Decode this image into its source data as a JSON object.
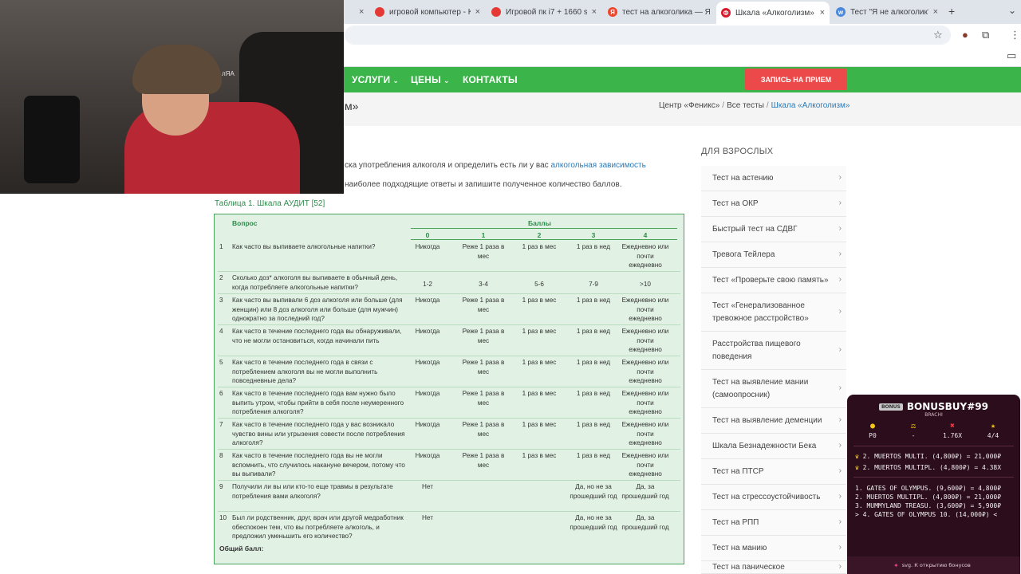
{
  "browser": {
    "tabs": [
      {
        "title": "игровой компьютер - Ку",
        "fav_color": "#e53935",
        "fav": "",
        "active": false
      },
      {
        "title": "Игровой пк i7 + 1660 su",
        "fav_color": "#e53935",
        "fav": "",
        "active": false
      },
      {
        "title": "тест на алкоголика — Ян",
        "fav_color": "#f0452b",
        "fav": "Я",
        "active": false
      },
      {
        "title": "Шкала «Алкоголизм» —",
        "fav_color": "#d81b2c",
        "fav": "Ф",
        "active": true
      },
      {
        "title": "Тест \"Я не алкоголик?\" |",
        "fav_color": "#4a89dc",
        "fav": "w",
        "active": false
      }
    ],
    "new_tab": "+",
    "tab_menu": "⌄",
    "close_glyph": "×",
    "toolbar_icons": {
      "star": "☆",
      "extension": "⧉",
      "profile": "●",
      "menu": "⋮",
      "folder": "▭"
    }
  },
  "site": {
    "nav": [
      "УСЛУГИ",
      "ЦЕНЫ",
      "КОНТАКТЫ"
    ],
    "cta": "ЗАПИСЬ НА ПРИЕМ",
    "page_title": "м»",
    "breadcrumbs": [
      "Центр «Феникс»",
      "Все тесты",
      "Шкала «Алкоголизм»"
    ],
    "intro1": "ска употребления алкоголя и определить есть ли у вас ",
    "intro1_link": "алкогольная зависимость",
    "intro2": "наиболее подходящие ответы и запишите полученное количество баллов.",
    "table_caption": "Таблица 1. Шкала АУДИТ [52]"
  },
  "audit": {
    "header_question": "Вопрос",
    "header_points": "Баллы",
    "score_cols": [
      "0",
      "1",
      "2",
      "3",
      "4"
    ],
    "rows": [
      {
        "n": "1",
        "q": "Как часто вы выпиваете алкогольные напитки?",
        "a": [
          "Никогда",
          "Реже 1 раза в мес",
          "1 раз в мес",
          "1 раз в нед",
          "Ежедневно или почти ежедневно"
        ]
      },
      {
        "n": "2",
        "q": "Сколько доз* алкоголя вы выпиваете в обычный день, когда потребляете алкогольные напитки?",
        "a": [
          "1-2",
          "3-4",
          "5-6",
          "7-9",
          ">10"
        ]
      },
      {
        "n": "3",
        "q": "Как часто вы выпивали 6 доз алкоголя или больше (для женщин) или 8 доз алкоголя или больше (для мужчин) однократно за последний год?",
        "a": [
          "Никогда",
          "Реже 1 раза в мес",
          "1 раз в мес",
          "1 раз в нед",
          "Ежедневно или почти ежедневно"
        ]
      },
      {
        "n": "4",
        "q": "Как часто в течение последнего года вы обнаруживали, что не могли остановиться, когда начинали пить",
        "a": [
          "Никогда",
          "Реже 1 раза в мес",
          "1 раз в мес",
          "1 раз в нед",
          "Ежедневно или почти ежедневно"
        ]
      },
      {
        "n": "5",
        "q": "Как часто в течение последнего года в связи с потреблением алкоголя вы не могли выполнить повседневные дела?",
        "a": [
          "Никогда",
          "Реже 1 раза в мес",
          "1 раз в мес",
          "1 раз в нед",
          "Ежедневно или почти ежедневно"
        ]
      },
      {
        "n": "6",
        "q": "Как часто в течение последнего года вам нужно было выпить утром, чтобы прийти в себя после неумеренного потребления алкоголя?",
        "a": [
          "Никогда",
          "Реже 1 раза в мес",
          "1 раз в мес",
          "1 раз в нед",
          "Ежедневно или почти ежедневно"
        ]
      },
      {
        "n": "7",
        "q": "Как часто в течение последнего года у вас возникало чувство вины или угрызения совести после потребления алкоголя?",
        "a": [
          "Никогда",
          "Реже 1 раза в мес",
          "1 раз в мес",
          "1 раз в нед",
          "Ежедневно или почти ежедневно"
        ]
      },
      {
        "n": "8",
        "q": "Как часто в течение последнего года вы не могли вспомнить, что случилось накануне вечером, потому что вы выпивали?",
        "a": [
          "Никогда",
          "Реже 1 раза в мес",
          "1 раз в мес",
          "1 раз в нед",
          "Ежедневно или почти ежедневно"
        ]
      },
      {
        "n": "9",
        "q": "Получили ли вы или кто-то еще травмы в результате потребления вами алкоголя?",
        "a": [
          "Нет",
          "",
          "",
          "Да, но не за прошедший год",
          "Да, за прошедший год"
        ]
      },
      {
        "n": "10",
        "q": "Был ли родственник, друг, врач или другой медработник обеспокоен тем, что вы потребляете алкоголь, и предложил уменьшить его количество?",
        "a": [
          "Нет",
          "",
          "",
          "Да, но не за прошедший год",
          "Да, за прошедший год"
        ]
      }
    ],
    "total": "Общий балл:"
  },
  "sidebar": {
    "heading": "ДЛЯ ВЗРОСЛЫХ",
    "items": [
      "Тест на астению",
      "Тест на ОКР",
      "Быстрый тест на СДВГ",
      "Тревога Тейлера",
      "Тест «Проверьте свою память»",
      "Тест «Генерализованное тревожное расстройство»",
      "Расстройства пищевого поведения",
      "Тест на выявление мании (самоопросник)",
      "Тест на выявление деменции",
      "Шкала Безнадежности Бека",
      "Тест на ПТСР",
      "Тест на стрессоустойчивость",
      "Тест на РПП",
      "Тест на манию",
      "Тест на паническое расстройство"
    ],
    "arrow": "›"
  },
  "webcam": {
    "label": "лЯА"
  },
  "widget": {
    "title": "BONUSBUY#99",
    "subtitle": "BRACHI",
    "stats": [
      {
        "icon": "●",
        "value": "P0",
        "color": "#f5c518"
      },
      {
        "icon": "⚖",
        "value": "-",
        "color": "#f5c518"
      },
      {
        "icon": "✖",
        "value": "1.76X",
        "color": "#e53946"
      },
      {
        "icon": "★",
        "value": "4/4",
        "color": "#f5c518"
      }
    ],
    "best": [
      "2. MUERTOS MULTI. (4,800₽) = 21,000₽",
      "2. MUERTOS MULTIPL. (4,800₽) = 4.38X"
    ],
    "list": [
      "1. GATES OF OLYMPUS. (9,600₽) = 4,800₽",
      "2. MUERTOS MULTIPL. (4,800₽) = 21,000₽",
      "3. MUMMYLAND TREASU. (3,600₽) = 5,900₽",
      "> 4. GATES OF OLYMPUS 10. (14,000₽) <"
    ],
    "footer": "svg. К открытию бонусов"
  }
}
